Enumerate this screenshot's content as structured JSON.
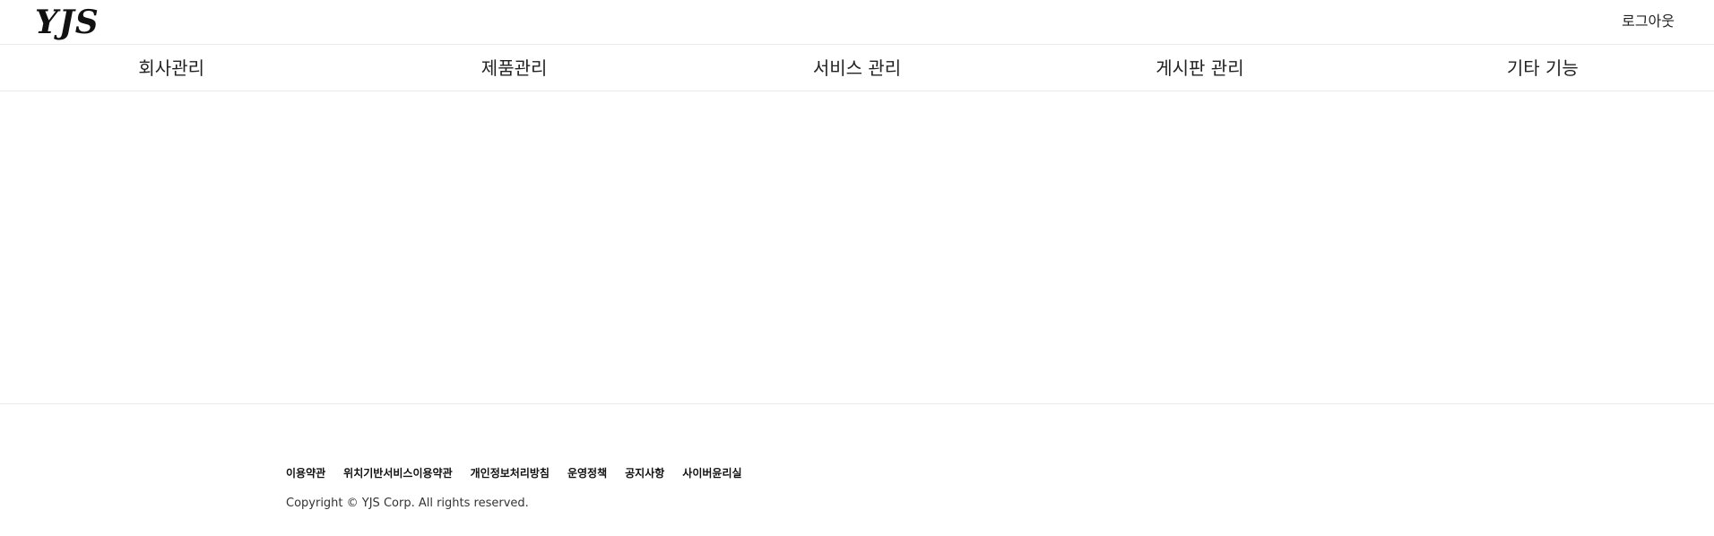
{
  "header": {
    "logo": "YJS",
    "logout_label": "로그아웃"
  },
  "nav": {
    "items": [
      {
        "label": "회사관리"
      },
      {
        "label": "제품관리"
      },
      {
        "label": "서비스 관리"
      },
      {
        "label": "게시판 관리"
      },
      {
        "label": "기타 기능"
      }
    ]
  },
  "footer": {
    "links": [
      {
        "label": "이용약관"
      },
      {
        "label": "위치기반서비스이용약관"
      },
      {
        "label": "개인정보처리방침"
      },
      {
        "label": "운영정책"
      },
      {
        "label": "공지사항"
      },
      {
        "label": "사이버윤리실"
      }
    ],
    "copyright": "Copyright © YJS Corp. All rights reserved."
  }
}
